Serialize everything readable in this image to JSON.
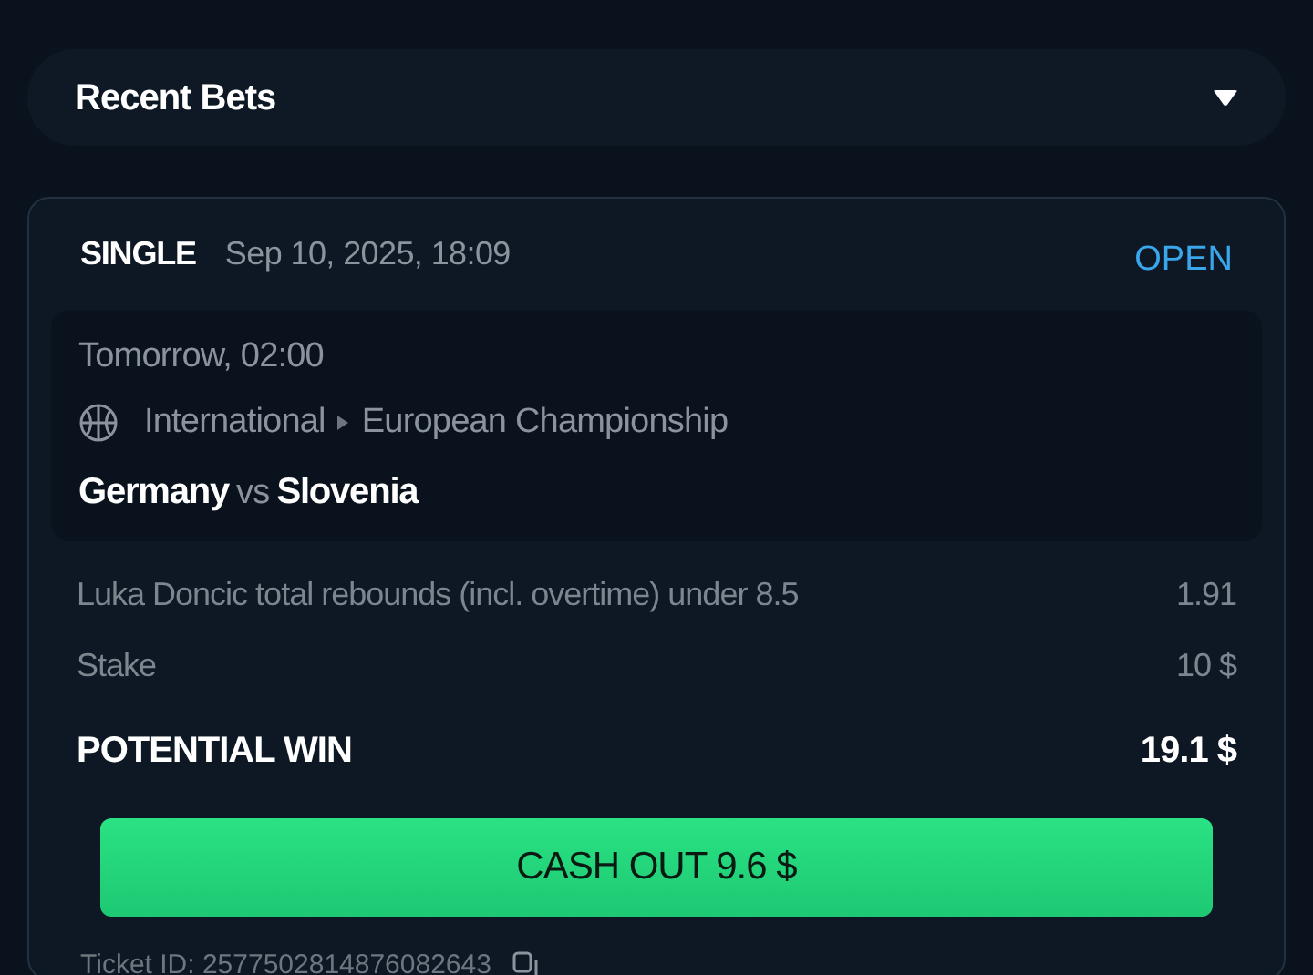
{
  "header": {
    "title": "Recent Bets",
    "expanded": false
  },
  "bet": {
    "type": "SINGLE",
    "placed": "Sep 10, 2025, 18:09",
    "status": "OPEN",
    "event": {
      "time": "Tomorrow, 02:00",
      "category": "International",
      "league": "European Championship",
      "home": "Germany",
      "vs": "vs",
      "away": "Slovenia"
    },
    "lines": [
      {
        "kind": "normal",
        "label": "Luka Doncic total rebounds (incl. overtime) under 8.5",
        "value": "1.91"
      },
      {
        "kind": "normal",
        "label": "Stake",
        "value": "10 $"
      },
      {
        "kind": "total",
        "label": "POTENTIAL WIN",
        "value": "19.1 $"
      }
    ],
    "cashout": "CASH OUT 9.6 $",
    "ticket": "Ticket ID: 2577502814876082643"
  }
}
